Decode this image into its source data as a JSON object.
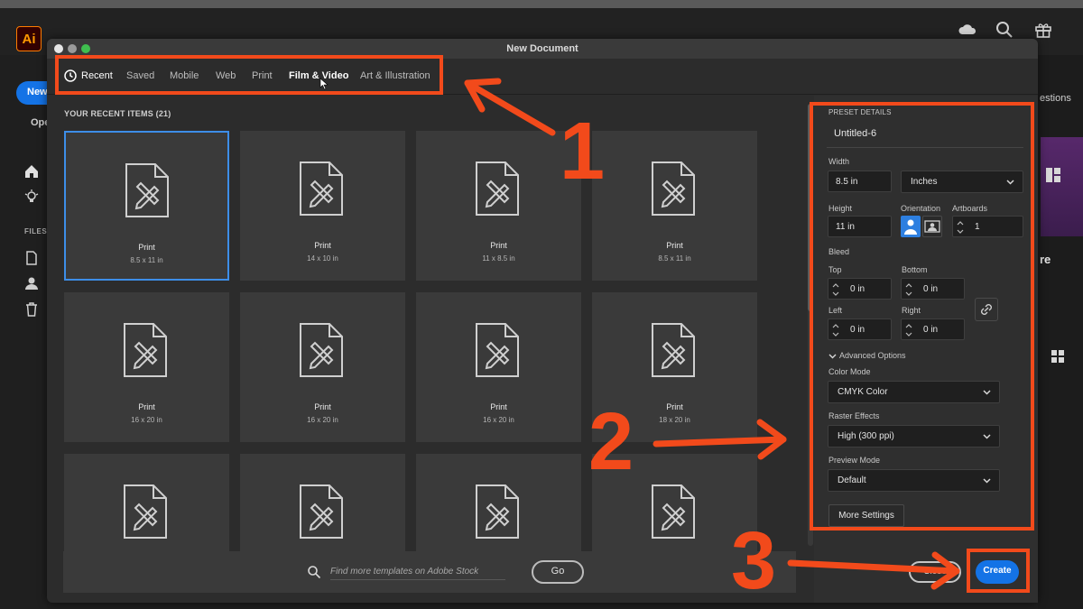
{
  "app": {
    "logo_text": "Ai"
  },
  "home": {
    "new_label": "New",
    "open_label": "Ope",
    "files_label": "FILES",
    "suggestions_label": "estions",
    "right_text": "re"
  },
  "dialog": {
    "title": "New Document",
    "tabs": [
      {
        "label": "Recent"
      },
      {
        "label": "Saved"
      },
      {
        "label": "Mobile"
      },
      {
        "label": "Web"
      },
      {
        "label": "Print"
      },
      {
        "label": "Film & Video"
      },
      {
        "label": "Art & Illustration"
      }
    ],
    "recent_header": "YOUR RECENT ITEMS",
    "recent_count": "(21)",
    "cards": [
      {
        "title": "Print",
        "size": "8.5 x 11 in"
      },
      {
        "title": "Print",
        "size": "14 x 10 in"
      },
      {
        "title": "Print",
        "size": "11 x 8.5 in"
      },
      {
        "title": "Print",
        "size": "8.5 x 11 in"
      },
      {
        "title": "Print",
        "size": "16 x 20 in"
      },
      {
        "title": "Print",
        "size": "16 x 20 in"
      },
      {
        "title": "Print",
        "size": "16 x 20 in"
      },
      {
        "title": "Print",
        "size": "18 x 20 in"
      },
      {
        "title": "",
        "size": ""
      },
      {
        "title": "",
        "size": ""
      },
      {
        "title": "",
        "size": ""
      },
      {
        "title": "",
        "size": ""
      }
    ],
    "search_placeholder": "Find more templates on Adobe Stock",
    "go_label": "Go"
  },
  "preset": {
    "section_label": "PRESET DETAILS",
    "name": "Untitled-6",
    "width_label": "Width",
    "width_value": "8.5 in",
    "units_value": "Inches",
    "height_label": "Height",
    "height_value": "11 in",
    "orientation_label": "Orientation",
    "artboards_label": "Artboards",
    "artboards_value": "1",
    "bleed_label": "Bleed",
    "top_label": "Top",
    "top_value": "0 in",
    "bottom_label": "Bottom",
    "bottom_value": "0 in",
    "left_label": "Left",
    "left_value": "0 in",
    "right_label": "Right",
    "right_value": "0 in",
    "advanced_label": "Advanced Options",
    "color_mode_label": "Color Mode",
    "color_mode_value": "CMYK Color",
    "raster_label": "Raster Effects",
    "raster_value": "High (300 ppi)",
    "preview_label": "Preview Mode",
    "preview_value": "Default",
    "more_settings_label": "More Settings",
    "close_label": "Close",
    "create_label": "Create"
  },
  "annotations": {
    "n1": "1",
    "n2": "2",
    "n3": "3"
  },
  "colors": {
    "accent": "#1473e6",
    "annotation": "#f24a1b"
  }
}
